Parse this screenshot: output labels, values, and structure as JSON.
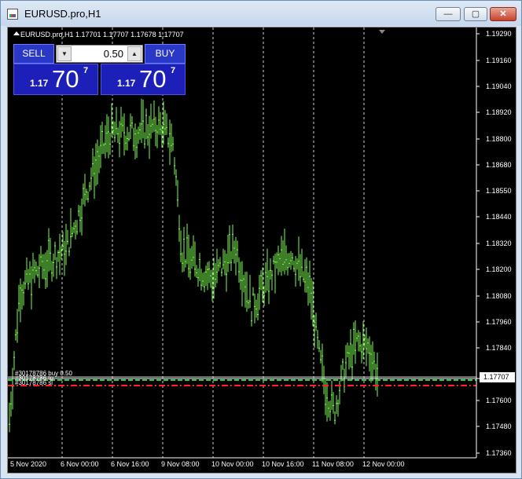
{
  "window": {
    "title": "EURUSD.pro,H1",
    "min_glyph": "—",
    "max_glyph": "▢",
    "close_glyph": "✕"
  },
  "chart_header": "EURUSD.pro,H1  1.17701 1.17707 1.17678 1.17707",
  "one_click": {
    "sell_label": "SELL",
    "buy_label": "BUY",
    "volume": "0.50",
    "bid": {
      "prefix": "1.17",
      "big": "70",
      "sup": "7"
    },
    "ask": {
      "prefix": "1.17",
      "big": "70",
      "sup": "7"
    }
  },
  "price_axis": [
    "1.19290",
    "1.19160",
    "1.19040",
    "1.18920",
    "1.18800",
    "1.18680",
    "1.18550",
    "1.18440",
    "1.18320",
    "1.18200",
    "1.18080",
    "1.17960",
    "1.17840",
    "1.17707",
    "1.17600",
    "1.17480",
    "1.17360"
  ],
  "current_price": "1.17707",
  "time_axis": [
    "5 Nov 2020",
    "6 Nov 00:00",
    "6 Nov 16:00",
    "9 Nov 08:00",
    "10 Nov 00:00",
    "10 Nov 16:00",
    "11 Nov 08:00",
    "12 Nov 00:00"
  ],
  "order_labels": [
    "#30178786 buy 0.50",
    "#30178786 tp",
    "#30178786 sl"
  ],
  "colors": {
    "candle": "#7cfc4f",
    "grid": "#cfcfcf",
    "tp": "#2ecc40",
    "sl": "#ff2020",
    "entry": "#cfcfcf"
  },
  "chart_data": {
    "type": "line",
    "x": [
      "5 Nov 2020",
      "6 Nov 00:00",
      "6 Nov 16:00",
      "9 Nov 08:00",
      "10 Nov 00:00",
      "10 Nov 16:00",
      "11 Nov 08:00",
      "12 Nov 00:00"
    ],
    "series": [
      {
        "values": [
          1.174,
          1.1825,
          1.1883,
          1.1888,
          1.1825,
          1.1822,
          1.1778,
          1.1772
        ]
      }
    ],
    "ylim": [
      1.173,
      1.1935
    ],
    "grid": true
  }
}
